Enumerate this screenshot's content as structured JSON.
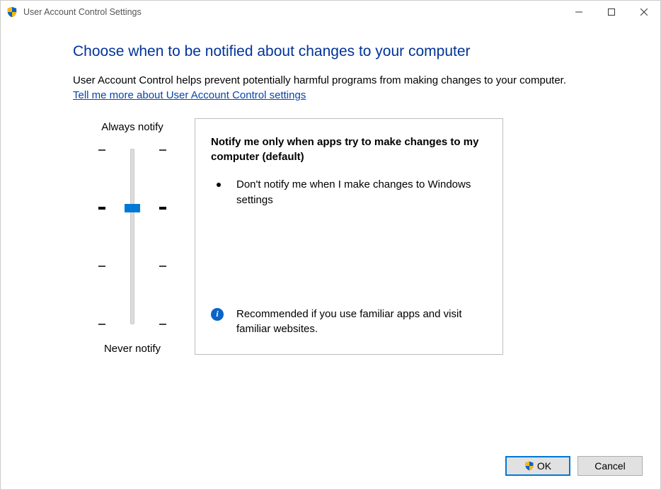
{
  "window": {
    "title": "User Account Control Settings"
  },
  "page": {
    "heading": "Choose when to be notified about changes to your computer",
    "intro": "User Account Control helps prevent potentially harmful programs from making changes to your computer.",
    "help_link": "Tell me more about User Account Control settings"
  },
  "slider": {
    "top_label": "Always notify",
    "bottom_label": "Never notify",
    "levels": 4,
    "current_level": 2
  },
  "details": {
    "title": "Notify me only when apps try to make changes to my computer (default)",
    "bullet": "Don't notify me when I make changes to Windows settings",
    "recommendation": "Recommended if you use familiar apps and visit familiar websites."
  },
  "buttons": {
    "ok": "OK",
    "cancel": "Cancel"
  }
}
